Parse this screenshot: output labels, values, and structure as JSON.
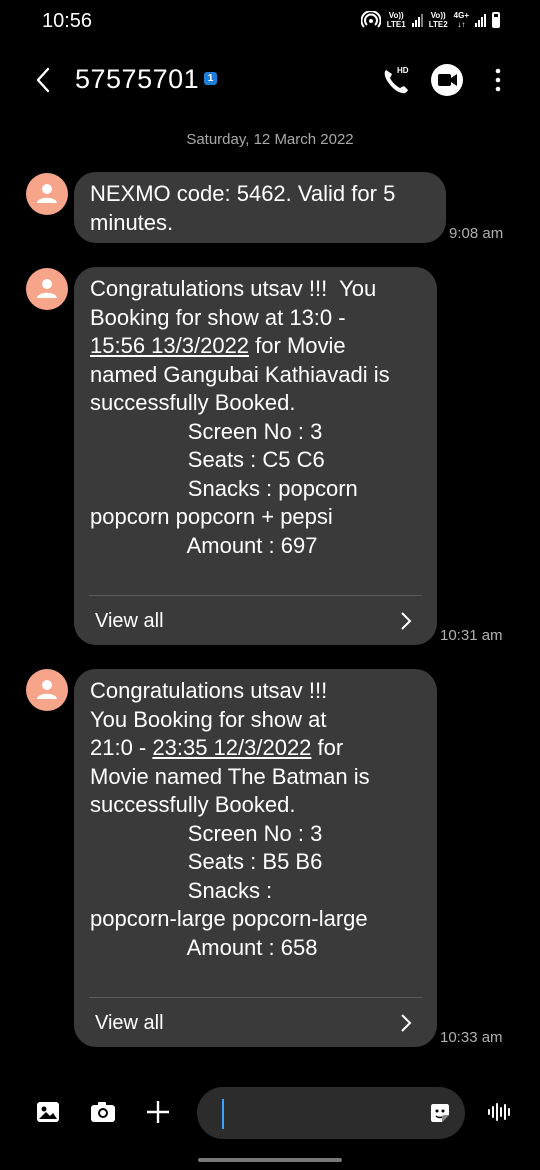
{
  "status_bar": {
    "time": "10:56",
    "sim1_label": "Vo))\nLTE1",
    "sim2_label": "Vo))\nLTE2",
    "network": "4G+"
  },
  "header": {
    "title": "57575701",
    "sim_badge": "1"
  },
  "date_divider": "Saturday, 12 March 2022",
  "messages": [
    {
      "lines": [
        "NEXMO code: 5462. Valid for 5",
        "minutes."
      ],
      "time": "9:08 am"
    },
    {
      "line1": "Congratulations utsav !!!  You",
      "line2": "Booking for show at 13:0 -",
      "line3_link": "15:56 13/3/2022",
      "line3_rest": " for Movie",
      "line4": "named Gangubai Kathiavadi is",
      "line5": "successfully Booked.",
      "line6": "                Screen No : 3",
      "line7": "                Seats : C5 C6",
      "line8": "                Snacks : popcorn",
      "line9": "popcorn popcorn + pepsi",
      "line10": "                Amount : 697",
      "view_all": "View all",
      "time": "10:31 am"
    },
    {
      "line1": "Congratulations utsav !!!",
      "line2": "You Booking for show at",
      "line3_pre": "21:0 - ",
      "line3_link": "23:35 12/3/2022",
      "line3_rest": " for",
      "line4": "Movie named The Batman is",
      "line5": "successfully Booked.",
      "line6": "                Screen No : 3",
      "line7": "                Seats : B5 B6",
      "line8": "                Snacks :",
      "line9": "popcorn-large popcorn-large",
      "line10": "                Amount : 658",
      "view_all": "View all",
      "time": "10:33 am"
    }
  ],
  "composer": {
    "icons": [
      "gallery-icon",
      "camera-icon",
      "plus-icon",
      "sticker-icon",
      "voice-icon"
    ]
  }
}
